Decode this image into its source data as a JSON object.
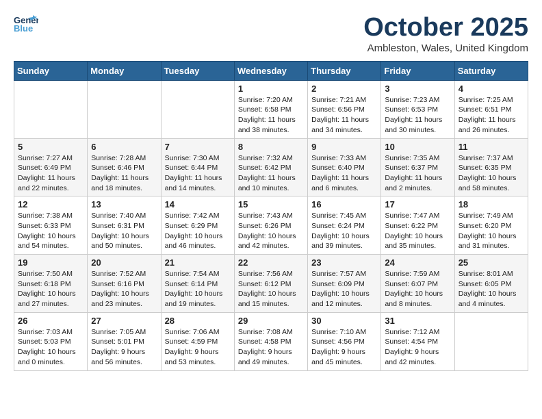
{
  "header": {
    "logo_general": "General",
    "logo_blue": "Blue",
    "month": "October 2025",
    "location": "Ambleston, Wales, United Kingdom"
  },
  "days_of_week": [
    "Sunday",
    "Monday",
    "Tuesday",
    "Wednesday",
    "Thursday",
    "Friday",
    "Saturday"
  ],
  "weeks": [
    [
      {
        "day": "",
        "sunrise": "",
        "sunset": "",
        "daylight": ""
      },
      {
        "day": "",
        "sunrise": "",
        "sunset": "",
        "daylight": ""
      },
      {
        "day": "",
        "sunrise": "",
        "sunset": "",
        "daylight": ""
      },
      {
        "day": "1",
        "sunrise": "Sunrise: 7:20 AM",
        "sunset": "Sunset: 6:58 PM",
        "daylight": "Daylight: 11 hours and 38 minutes."
      },
      {
        "day": "2",
        "sunrise": "Sunrise: 7:21 AM",
        "sunset": "Sunset: 6:56 PM",
        "daylight": "Daylight: 11 hours and 34 minutes."
      },
      {
        "day": "3",
        "sunrise": "Sunrise: 7:23 AM",
        "sunset": "Sunset: 6:53 PM",
        "daylight": "Daylight: 11 hours and 30 minutes."
      },
      {
        "day": "4",
        "sunrise": "Sunrise: 7:25 AM",
        "sunset": "Sunset: 6:51 PM",
        "daylight": "Daylight: 11 hours and 26 minutes."
      }
    ],
    [
      {
        "day": "5",
        "sunrise": "Sunrise: 7:27 AM",
        "sunset": "Sunset: 6:49 PM",
        "daylight": "Daylight: 11 hours and 22 minutes."
      },
      {
        "day": "6",
        "sunrise": "Sunrise: 7:28 AM",
        "sunset": "Sunset: 6:46 PM",
        "daylight": "Daylight: 11 hours and 18 minutes."
      },
      {
        "day": "7",
        "sunrise": "Sunrise: 7:30 AM",
        "sunset": "Sunset: 6:44 PM",
        "daylight": "Daylight: 11 hours and 14 minutes."
      },
      {
        "day": "8",
        "sunrise": "Sunrise: 7:32 AM",
        "sunset": "Sunset: 6:42 PM",
        "daylight": "Daylight: 11 hours and 10 minutes."
      },
      {
        "day": "9",
        "sunrise": "Sunrise: 7:33 AM",
        "sunset": "Sunset: 6:40 PM",
        "daylight": "Daylight: 11 hours and 6 minutes."
      },
      {
        "day": "10",
        "sunrise": "Sunrise: 7:35 AM",
        "sunset": "Sunset: 6:37 PM",
        "daylight": "Daylight: 11 hours and 2 minutes."
      },
      {
        "day": "11",
        "sunrise": "Sunrise: 7:37 AM",
        "sunset": "Sunset: 6:35 PM",
        "daylight": "Daylight: 10 hours and 58 minutes."
      }
    ],
    [
      {
        "day": "12",
        "sunrise": "Sunrise: 7:38 AM",
        "sunset": "Sunset: 6:33 PM",
        "daylight": "Daylight: 10 hours and 54 minutes."
      },
      {
        "day": "13",
        "sunrise": "Sunrise: 7:40 AM",
        "sunset": "Sunset: 6:31 PM",
        "daylight": "Daylight: 10 hours and 50 minutes."
      },
      {
        "day": "14",
        "sunrise": "Sunrise: 7:42 AM",
        "sunset": "Sunset: 6:29 PM",
        "daylight": "Daylight: 10 hours and 46 minutes."
      },
      {
        "day": "15",
        "sunrise": "Sunrise: 7:43 AM",
        "sunset": "Sunset: 6:26 PM",
        "daylight": "Daylight: 10 hours and 42 minutes."
      },
      {
        "day": "16",
        "sunrise": "Sunrise: 7:45 AM",
        "sunset": "Sunset: 6:24 PM",
        "daylight": "Daylight: 10 hours and 39 minutes."
      },
      {
        "day": "17",
        "sunrise": "Sunrise: 7:47 AM",
        "sunset": "Sunset: 6:22 PM",
        "daylight": "Daylight: 10 hours and 35 minutes."
      },
      {
        "day": "18",
        "sunrise": "Sunrise: 7:49 AM",
        "sunset": "Sunset: 6:20 PM",
        "daylight": "Daylight: 10 hours and 31 minutes."
      }
    ],
    [
      {
        "day": "19",
        "sunrise": "Sunrise: 7:50 AM",
        "sunset": "Sunset: 6:18 PM",
        "daylight": "Daylight: 10 hours and 27 minutes."
      },
      {
        "day": "20",
        "sunrise": "Sunrise: 7:52 AM",
        "sunset": "Sunset: 6:16 PM",
        "daylight": "Daylight: 10 hours and 23 minutes."
      },
      {
        "day": "21",
        "sunrise": "Sunrise: 7:54 AM",
        "sunset": "Sunset: 6:14 PM",
        "daylight": "Daylight: 10 hours and 19 minutes."
      },
      {
        "day": "22",
        "sunrise": "Sunrise: 7:56 AM",
        "sunset": "Sunset: 6:12 PM",
        "daylight": "Daylight: 10 hours and 15 minutes."
      },
      {
        "day": "23",
        "sunrise": "Sunrise: 7:57 AM",
        "sunset": "Sunset: 6:09 PM",
        "daylight": "Daylight: 10 hours and 12 minutes."
      },
      {
        "day": "24",
        "sunrise": "Sunrise: 7:59 AM",
        "sunset": "Sunset: 6:07 PM",
        "daylight": "Daylight: 10 hours and 8 minutes."
      },
      {
        "day": "25",
        "sunrise": "Sunrise: 8:01 AM",
        "sunset": "Sunset: 6:05 PM",
        "daylight": "Daylight: 10 hours and 4 minutes."
      }
    ],
    [
      {
        "day": "26",
        "sunrise": "Sunrise: 7:03 AM",
        "sunset": "Sunset: 5:03 PM",
        "daylight": "Daylight: 10 hours and 0 minutes."
      },
      {
        "day": "27",
        "sunrise": "Sunrise: 7:05 AM",
        "sunset": "Sunset: 5:01 PM",
        "daylight": "Daylight: 9 hours and 56 minutes."
      },
      {
        "day": "28",
        "sunrise": "Sunrise: 7:06 AM",
        "sunset": "Sunset: 4:59 PM",
        "daylight": "Daylight: 9 hours and 53 minutes."
      },
      {
        "day": "29",
        "sunrise": "Sunrise: 7:08 AM",
        "sunset": "Sunset: 4:58 PM",
        "daylight": "Daylight: 9 hours and 49 minutes."
      },
      {
        "day": "30",
        "sunrise": "Sunrise: 7:10 AM",
        "sunset": "Sunset: 4:56 PM",
        "daylight": "Daylight: 9 hours and 45 minutes."
      },
      {
        "day": "31",
        "sunrise": "Sunrise: 7:12 AM",
        "sunset": "Sunset: 4:54 PM",
        "daylight": "Daylight: 9 hours and 42 minutes."
      },
      {
        "day": "",
        "sunrise": "",
        "sunset": "",
        "daylight": ""
      }
    ]
  ]
}
